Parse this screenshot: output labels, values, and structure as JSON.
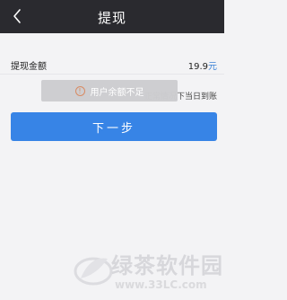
{
  "header": {
    "back_icon": "chevron-left-icon",
    "title": "提现"
  },
  "toast": {
    "icon": "exclamation-circle-icon",
    "icon_glyph": "!",
    "message": "用户余额不足"
  },
  "withdraw": {
    "label": "提现金额",
    "amount": "19.9",
    "unit": "元"
  },
  "note": "正常情况下当日到账",
  "actions": {
    "next_label": "下一步"
  },
  "watermark": {
    "name": "绿茶软件园",
    "url": "www.33LC.com"
  },
  "colors": {
    "header_bg": "#2a2a2f",
    "primary": "#3784e6",
    "page_bg": "#f3f3f5"
  }
}
